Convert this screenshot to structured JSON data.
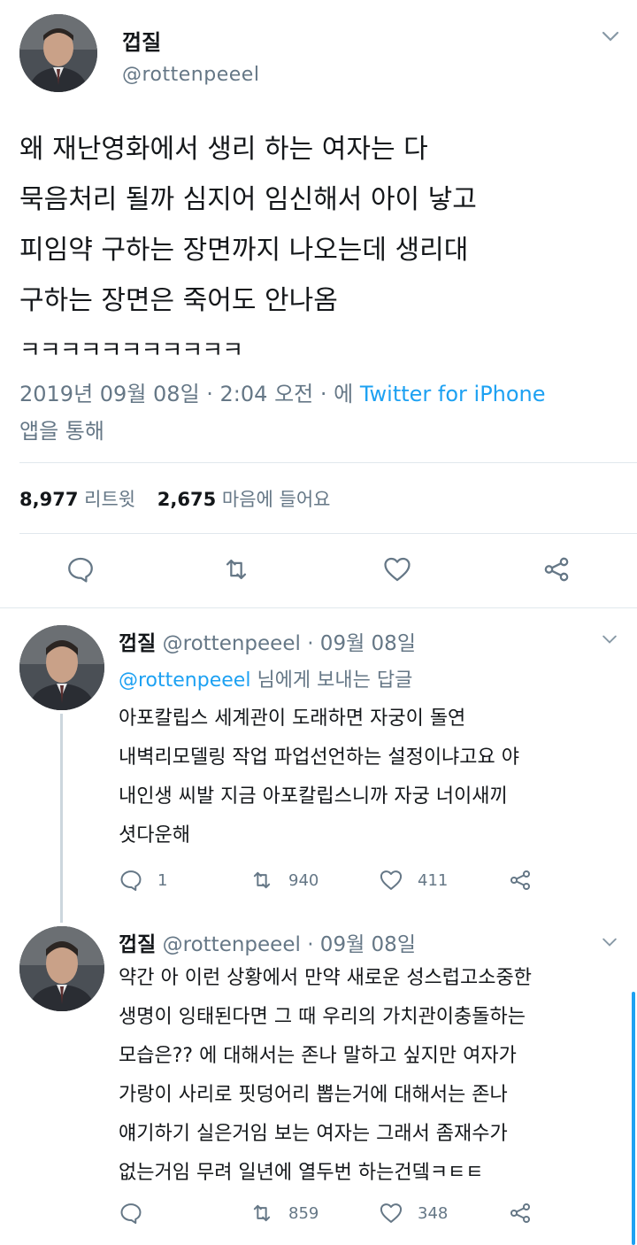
{
  "main_tweet": {
    "name": "껍질",
    "handle": "@rottenpeeel",
    "text_lines": [
      "왜 재난영화에서 생리 하는 여자는 다",
      "묵음처리 될까  심지어 임신해서 아이 낳고",
      "피임약 구하는 장면까지 나오는데 생리대",
      "구하는 장면은 죽어도 안나옴"
    ],
    "text_laugh": "ㅋㅋㅋㅋㅋㅋㅋㅋㅋㅋㅋ",
    "meta_prefix": "2019년 09월 08일 · 2:04 오전 · 에 ",
    "meta_source": "Twitter for iPhone",
    "meta_suffix": "앱을 통해",
    "retweet_count": "8,977",
    "retweet_label": "리트윗",
    "like_count": "2,675",
    "like_label": "마음에 들어요"
  },
  "replies": [
    {
      "name": "껍질",
      "handle": "@rottenpeeel",
      "date": "· 09월 08일",
      "reply_to_handle": "@rottenpeeel",
      "reply_to_suffix": "님에게 보내는 답글",
      "text_lines": [
        "아포칼립스 세계관이 도래하면 자궁이 돌연",
        "내벽리모델링 작업 파업선언하는 설정이냐고요 야",
        "내인생 씨발 지금 아포칼립스니까 자궁 너이새끼",
        "셧다운해"
      ],
      "reply_count": "1",
      "retweet_count": "940",
      "like_count": "411"
    },
    {
      "name": "껍질",
      "handle": "@rottenpeeel",
      "date": "· 09월 08일",
      "text_lines": [
        "약간 아 이런 상황에서 만약 새로운 성스럽고소중한",
        "생명이 잉태된다면 그 때 우리의 가치관이충돌하는",
        "모습은?? 에 대해서는 존나 말하고 싶지만 여자가",
        "가랑이 사리로 핏덩어리 뽑는거에 대해서는 존나",
        "얘기하기 실은거임 보는 여자는 그래서 좀재수가",
        "없는거임  무려 일년에 열두번 하는건뎈ㅋㅌㅌ"
      ],
      "retweet_count": "859",
      "like_count": "348"
    }
  ],
  "icons": [
    "chevron-down-icon",
    "reply-icon",
    "retweet-icon",
    "like-icon",
    "share-icon"
  ],
  "colors": {
    "link": "#1da1f2",
    "muted": "#657786",
    "text": "#14171a"
  }
}
